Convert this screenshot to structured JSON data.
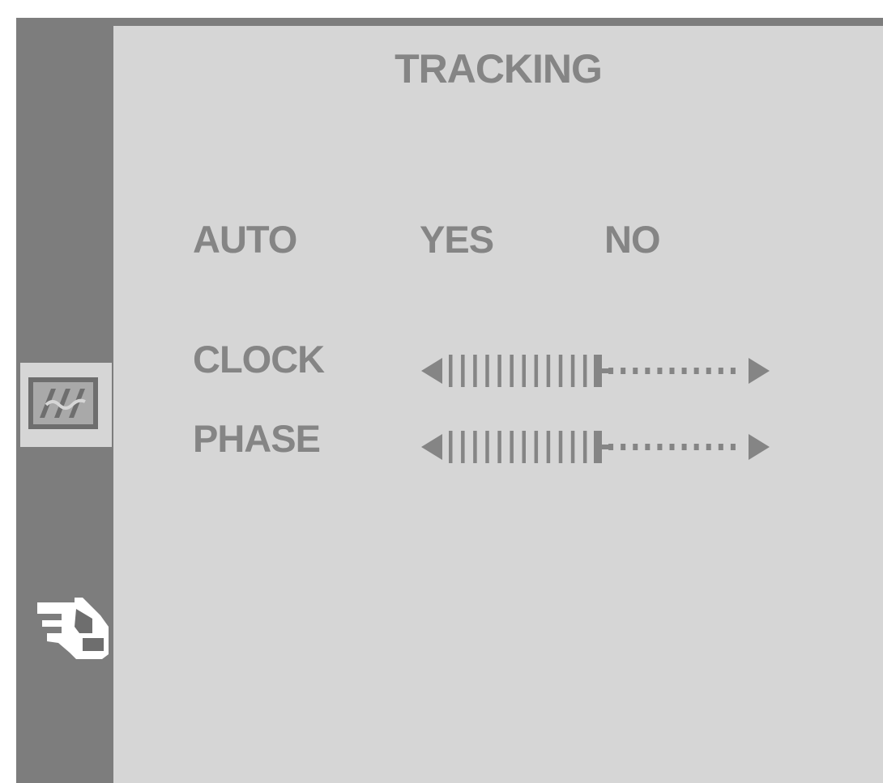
{
  "header": {
    "title": "TRACKING"
  },
  "sidebar": {
    "tabs": [
      {
        "icon": "tracking-waves-icon",
        "selected": true
      },
      {
        "icon": "hand-pointer-icon",
        "selected": false
      }
    ]
  },
  "auto": {
    "label": "AUTO",
    "options": [
      "YES",
      "NO"
    ]
  },
  "clock": {
    "label": "CLOCK",
    "level": 0.5
  },
  "phase": {
    "label": "PHASE",
    "level": 0.5
  },
  "colors": {
    "frame": "#7d7d7d",
    "panel": "#d6d6d6",
    "text": "#858585",
    "icon_dark": "#6e6e6e"
  }
}
